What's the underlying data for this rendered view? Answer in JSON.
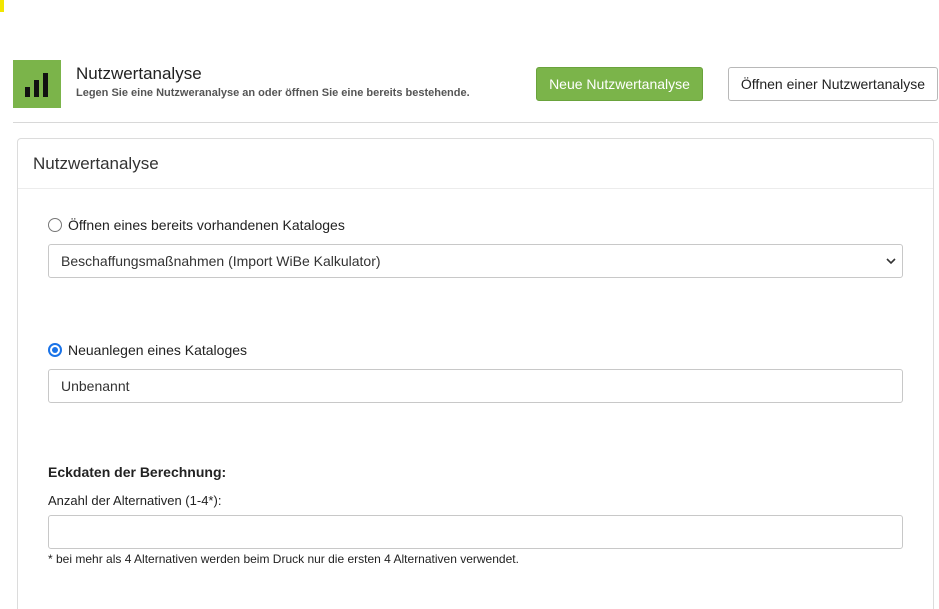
{
  "header": {
    "title": "Nutzwertanalyse",
    "subtitle": "Legen Sie eine Nutzweranalyse an oder öffnen Sie eine bereits bestehende.",
    "new_button": "Neue Nutzwertanalyse",
    "open_button": "Öffnen einer Nutzwertanalyse",
    "accent_color": "#7bb44a"
  },
  "panel": {
    "title": "Nutzwertanalyse",
    "open_option": {
      "label": "Öffnen eines bereits vorhandenen Kataloges",
      "selected": false,
      "catalog_value": "Beschaffungsmaßnahmen (Import WiBe Kalkulator)"
    },
    "new_option": {
      "label": "Neuanlegen eines Kataloges",
      "selected": true,
      "name_value": "Unbenannt"
    },
    "basics": {
      "heading": "Eckdaten der Berechnung:",
      "alternatives_label": "Anzahl der Alternativen (1-4*):",
      "alternatives_value": "",
      "footnote": "* bei mehr als 4 Alternativen werden beim Druck nur die ersten 4 Alternativen verwendet."
    }
  }
}
